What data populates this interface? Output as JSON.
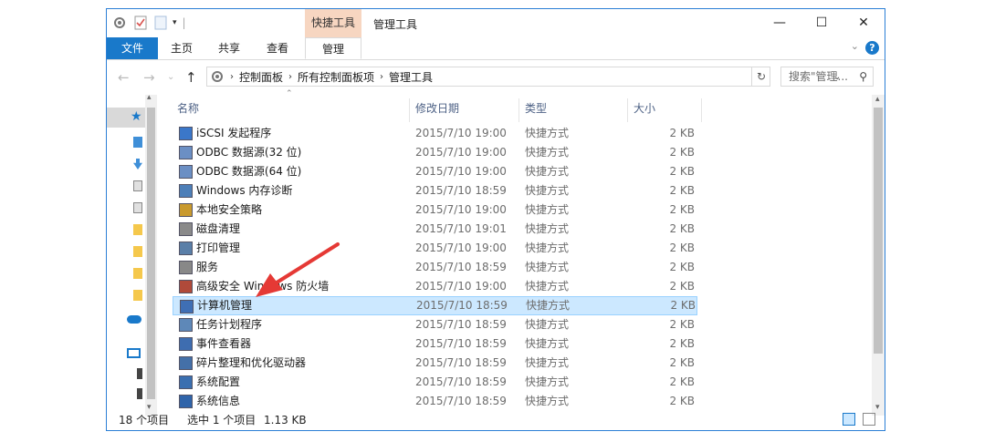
{
  "titlebar": {
    "context_tab": "快捷工具",
    "title": "管理工具",
    "minimize": "—",
    "maximize": "☐",
    "close": "✕"
  },
  "ribbon": {
    "file": "文件",
    "tabs": [
      "主页",
      "共享",
      "查看"
    ],
    "active_tab": "管理",
    "help": "?"
  },
  "address": {
    "crumbs": [
      "控制面板",
      "所有控制面板项",
      "管理工具"
    ],
    "search_placeholder": "搜索\"管理...",
    "refresh": "↻"
  },
  "columns": {
    "name": "名称",
    "date": "修改日期",
    "type": "类型",
    "size": "大小"
  },
  "files": [
    {
      "name": "iSCSI 发起程序",
      "date": "2015/7/10 19:00",
      "type": "快捷方式",
      "size": "2 KB"
    },
    {
      "name": "ODBC 数据源(32 位)",
      "date": "2015/7/10 19:00",
      "type": "快捷方式",
      "size": "2 KB"
    },
    {
      "name": "ODBC 数据源(64 位)",
      "date": "2015/7/10 19:00",
      "type": "快捷方式",
      "size": "2 KB"
    },
    {
      "name": "Windows 内存诊断",
      "date": "2015/7/10 18:59",
      "type": "快捷方式",
      "size": "2 KB"
    },
    {
      "name": "本地安全策略",
      "date": "2015/7/10 19:00",
      "type": "快捷方式",
      "size": "2 KB"
    },
    {
      "name": "磁盘清理",
      "date": "2015/7/10 19:01",
      "type": "快捷方式",
      "size": "2 KB"
    },
    {
      "name": "打印管理",
      "date": "2015/7/10 19:00",
      "type": "快捷方式",
      "size": "2 KB"
    },
    {
      "name": "服务",
      "date": "2015/7/10 18:59",
      "type": "快捷方式",
      "size": "2 KB"
    },
    {
      "name": "高级安全 Windows 防火墙",
      "date": "2015/7/10 19:00",
      "type": "快捷方式",
      "size": "2 KB"
    },
    {
      "name": "计算机管理",
      "date": "2015/7/10 18:59",
      "type": "快捷方式",
      "size": "2 KB"
    },
    {
      "name": "任务计划程序",
      "date": "2015/7/10 18:59",
      "type": "快捷方式",
      "size": "2 KB"
    },
    {
      "name": "事件查看器",
      "date": "2015/7/10 18:59",
      "type": "快捷方式",
      "size": "2 KB"
    },
    {
      "name": "碎片整理和优化驱动器",
      "date": "2015/7/10 18:59",
      "type": "快捷方式",
      "size": "2 KB"
    },
    {
      "name": "系统配置",
      "date": "2015/7/10 18:59",
      "type": "快捷方式",
      "size": "2 KB"
    },
    {
      "name": "系统信息",
      "date": "2015/7/10 18:59",
      "type": "快捷方式",
      "size": "2 KB"
    }
  ],
  "selected_index": 9,
  "status": {
    "count": "18 个项目",
    "selection": "选中 1 个项目",
    "size": "1.13 KB"
  },
  "colors": {
    "accent": "#1979ca",
    "selection_bg": "#cce8ff",
    "context_tab": "#f7d6c1",
    "arrow": "#e53935"
  }
}
